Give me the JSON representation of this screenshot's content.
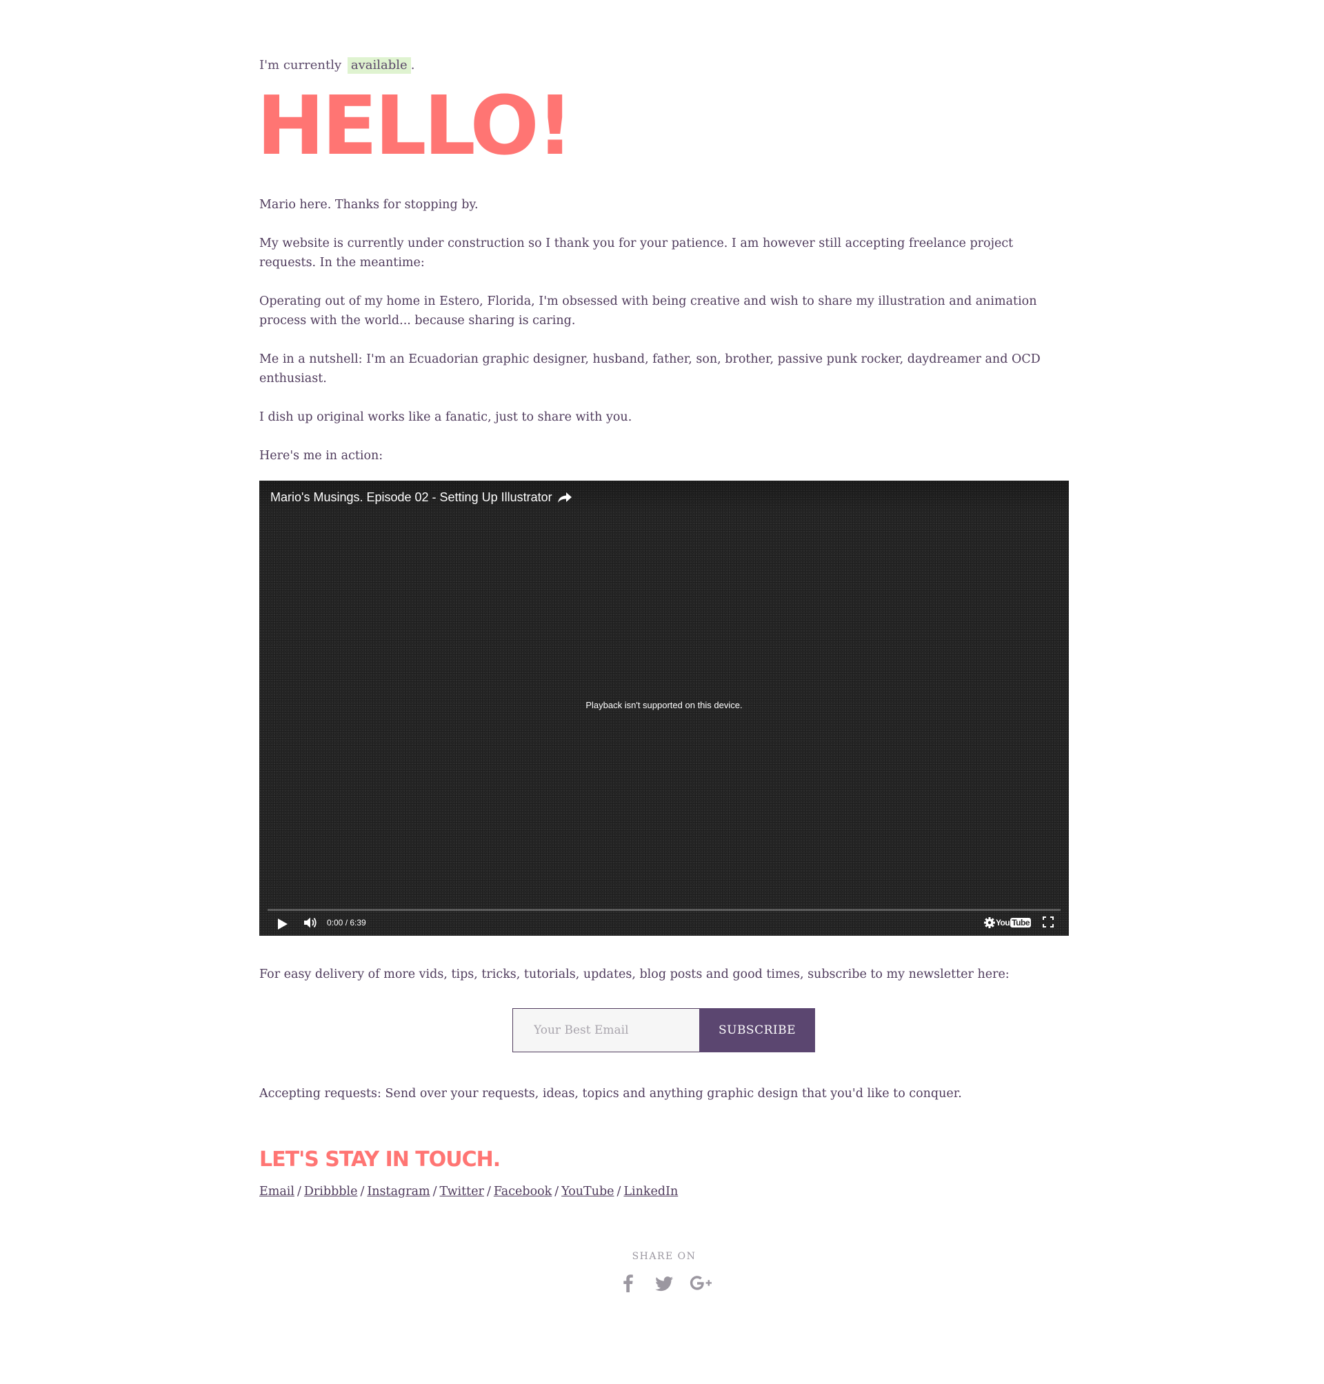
{
  "status": {
    "prefix": "I'm currently",
    "badge": "available",
    "suffix": "."
  },
  "hero": {
    "title": "HELLO!"
  },
  "intro": {
    "p1": "Mario here. Thanks for stopping by.",
    "p2": "My website is currently under construction so I thank you for your patience. I am however still accepting freelance project requests. In the meantime:",
    "p3": "Operating out of my home in Estero, Florida, I'm obsessed with being creative and wish to share my illustration and animation process with the world... because sharing is caring.",
    "p4": "Me in a nutshell: I'm an Ecuadorian graphic designer, husband, father, son, brother, passive punk rocker, daydreamer and OCD enthusiast.",
    "p5": "I dish up original works like a fanatic, just to share with you.",
    "p6": "Here's me in action:"
  },
  "video": {
    "title": "Mario's Musings. Episode 02 - Setting Up Illustrator",
    "message": "Playback isn't supported on this device.",
    "time": "0:00 / 6:39",
    "logo_you": "You",
    "logo_tube": "Tube",
    "progress": 0
  },
  "newsletter": {
    "text": "For easy delivery of more vids, tips, tricks, tutorials, updates, blog posts and good times, subscribe to my newsletter here:",
    "placeholder": "Your Best Email",
    "value": "",
    "button": "SUBSCRIBE"
  },
  "requests": {
    "text": "Accepting requests: Send over your requests, ideas, topics and anything graphic design that you'd like to conquer."
  },
  "contact": {
    "heading": "LET'S STAY IN TOUCH.",
    "separator": "/",
    "links": [
      "Email",
      "Dribbble",
      "Instagram",
      "Twitter",
      "Facebook",
      "YouTube",
      "LinkedIn"
    ]
  },
  "share": {
    "label": "SHARE ON",
    "icons": [
      "facebook-icon",
      "twitter-icon",
      "google-plus-icon"
    ],
    "icon_color": "#9b97a0"
  },
  "colors": {
    "accent": "#ff7573",
    "text": "#4f3b5c",
    "badge_bg": "#dff3d0",
    "button_bg": "#5b4670"
  }
}
